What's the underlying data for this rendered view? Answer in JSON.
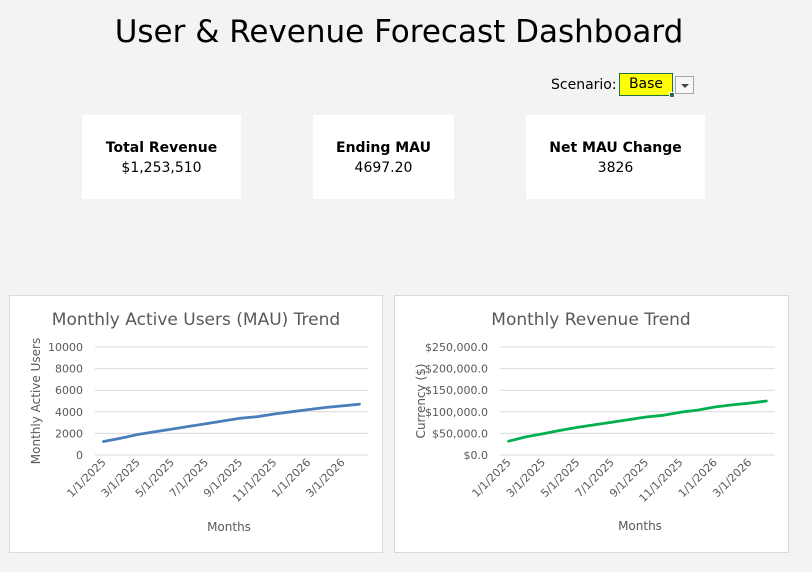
{
  "dashboard": {
    "title": "User & Revenue Forecast Dashboard",
    "scenario_label": "Scenario:",
    "scenario_value": "Base",
    "highlight_color": "#ffff00"
  },
  "kpis": [
    {
      "label": "Total Revenue",
      "value": "$1,253,510"
    },
    {
      "label": "Ending MAU",
      "value": "4697.20"
    },
    {
      "label": "Net MAU Change",
      "value": "3826"
    }
  ],
  "chart_data": [
    {
      "type": "line",
      "title": "Monthly Active Users (MAU) Trend",
      "xlabel": "Months",
      "ylabel": "Monthly Active Users",
      "color": "#4a7ebb",
      "ylim": [
        0,
        10000
      ],
      "yticks": [
        "0",
        "2000",
        "4000",
        "6000",
        "8000",
        "10000"
      ],
      "xtick_labels": [
        "1/1/2025",
        "3/1/2025",
        "5/1/2025",
        "7/1/2025",
        "9/1/2025",
        "11/1/2025",
        "1/1/2026",
        "3/1/2026"
      ],
      "grid": true,
      "x": [
        "1/1/2025",
        "2/1/2025",
        "3/1/2025",
        "4/1/2025",
        "5/1/2025",
        "6/1/2025",
        "7/1/2025",
        "8/1/2025",
        "9/1/2025",
        "10/1/2025",
        "11/1/2025",
        "12/1/2025",
        "1/1/2026",
        "2/1/2026",
        "3/1/2026",
        "4/1/2026"
      ],
      "values": [
        1250,
        1550,
        1900,
        2150,
        2400,
        2650,
        2900,
        3150,
        3400,
        3550,
        3800,
        4000,
        4200,
        4400,
        4550,
        4700
      ]
    },
    {
      "type": "line",
      "title": "Monthly Revenue Trend",
      "xlabel": "Months",
      "ylabel": "Currency ($)",
      "color": "#00b050",
      "ylim": [
        0,
        250000
      ],
      "yticks": [
        "$0.0",
        "$50,000.0",
        "$100,000.0",
        "$150,000.0",
        "$200,000.0",
        "$250,000.0"
      ],
      "xtick_labels": [
        "1/1/2025",
        "3/1/2025",
        "5/1/2025",
        "7/1/2025",
        "9/1/2025",
        "11/1/2025",
        "1/1/2026",
        "3/1/2026"
      ],
      "grid": true,
      "x": [
        "1/1/2025",
        "2/1/2025",
        "3/1/2025",
        "4/1/2025",
        "5/1/2025",
        "6/1/2025",
        "7/1/2025",
        "8/1/2025",
        "9/1/2025",
        "10/1/2025",
        "11/1/2025",
        "12/1/2025",
        "1/1/2026",
        "2/1/2026",
        "3/1/2026",
        "4/1/2026"
      ],
      "values": [
        32000,
        42000,
        49000,
        57000,
        64000,
        70000,
        76000,
        82000,
        88000,
        92000,
        99000,
        104000,
        111000,
        116000,
        120000,
        125000
      ]
    }
  ]
}
